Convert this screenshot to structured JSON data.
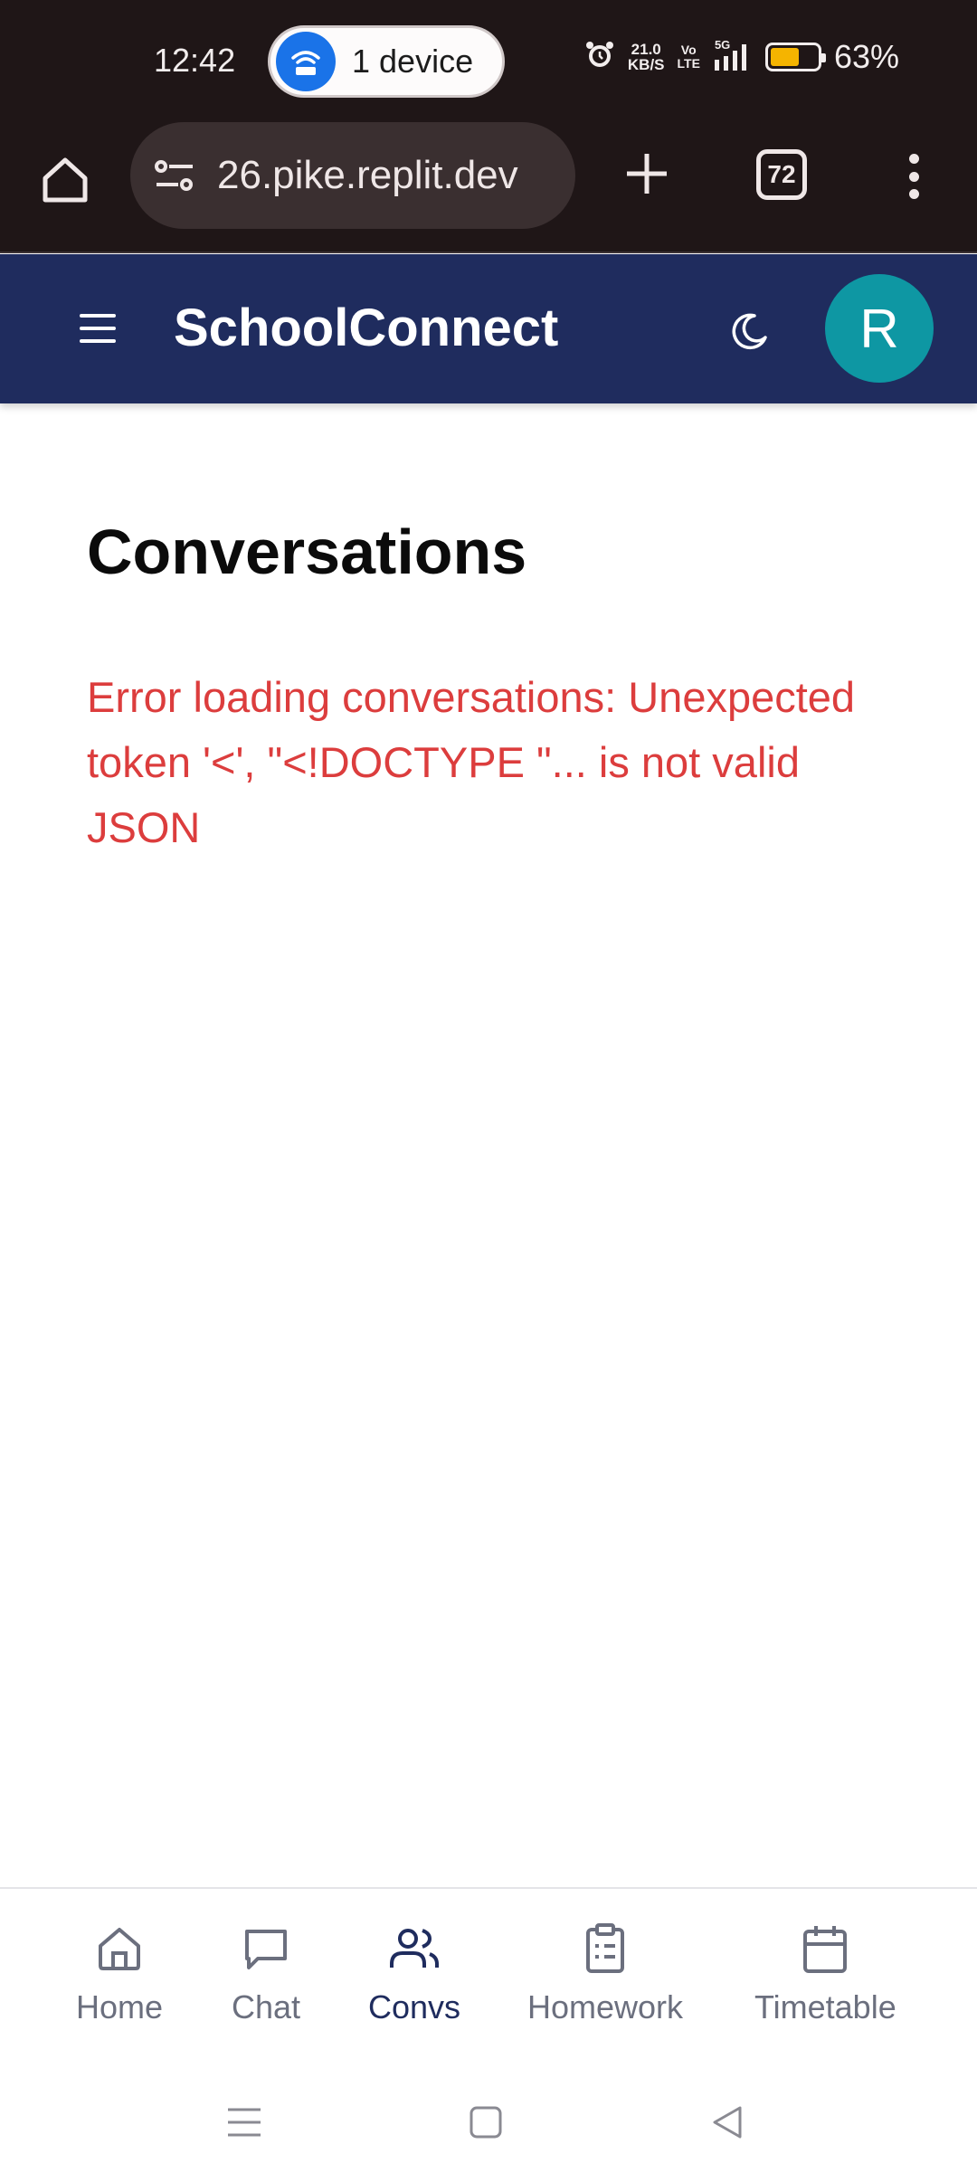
{
  "status_bar": {
    "time": "12:42",
    "pill_label": "1 device",
    "net_speed_value": "21.0",
    "net_speed_unit": "KB/S",
    "volte_top": "Vo",
    "volte_bottom": "LTE",
    "network_type": "5G",
    "battery_level": 0.63,
    "battery_percent": "63%",
    "battery_color": "#f5b400"
  },
  "browser": {
    "url": "26.pike.replit.dev",
    "tab_count": "72"
  },
  "app": {
    "title": "SchoolConnect",
    "avatar_initial": "R",
    "header_color": "#1f2c5e",
    "avatar_color": "#0e97a3"
  },
  "main": {
    "page_title": "Conversations",
    "error_message": "Error loading conversations: Unexpected token '<', \"<!DOCTYPE \"... is not valid JSON",
    "error_color": "#dc3d3d"
  },
  "bottom_nav": {
    "items": [
      {
        "label": "Home",
        "icon": "home-icon",
        "active": false
      },
      {
        "label": "Chat",
        "icon": "chat-icon",
        "active": false
      },
      {
        "label": "Convs",
        "icon": "users-icon",
        "active": true
      },
      {
        "label": "Homework",
        "icon": "clipboard-icon",
        "active": false
      },
      {
        "label": "Timetable",
        "icon": "calendar-icon",
        "active": false
      }
    ]
  }
}
